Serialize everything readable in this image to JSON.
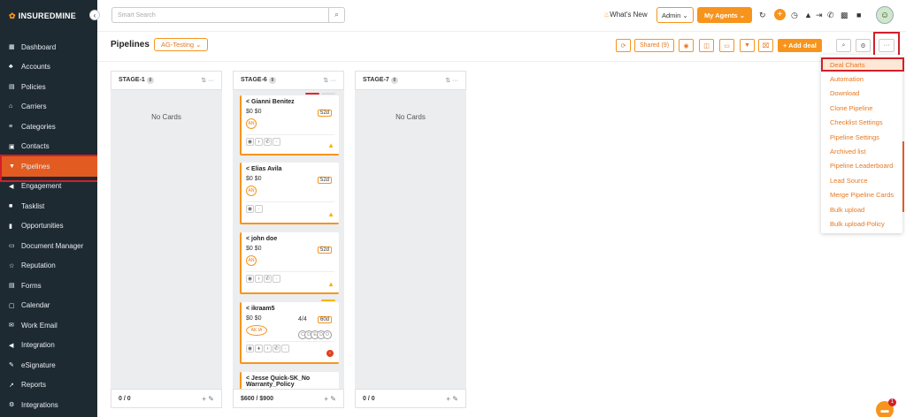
{
  "brand": {
    "name_bold": "INSURED",
    "name_rest": "MINE",
    "accent": "#f7941d"
  },
  "sidebar": {
    "items": [
      {
        "label": "Dashboard",
        "icon": "dashboard-icon"
      },
      {
        "label": "Accounts",
        "icon": "accounts-icon"
      },
      {
        "label": "Policies",
        "icon": "policies-icon"
      },
      {
        "label": "Carriers",
        "icon": "carriers-icon"
      },
      {
        "label": "Categories",
        "icon": "categories-icon"
      },
      {
        "label": "Contacts",
        "icon": "contacts-icon"
      },
      {
        "label": "Pipelines",
        "icon": "pipelines-icon",
        "active": true
      },
      {
        "label": "Engagement",
        "icon": "engagement-icon"
      },
      {
        "label": "Tasklist",
        "icon": "tasklist-icon"
      },
      {
        "label": "Opportunities",
        "icon": "opportunities-icon"
      },
      {
        "label": "Document Manager",
        "icon": "document-manager-icon"
      },
      {
        "label": "Reputation",
        "icon": "reputation-icon"
      },
      {
        "label": "Forms",
        "icon": "forms-icon"
      },
      {
        "label": "Calendar",
        "icon": "calendar-icon"
      },
      {
        "label": "Work Email",
        "icon": "work-email-icon"
      },
      {
        "label": "Integration",
        "icon": "integration-icon"
      },
      {
        "label": "eSignature",
        "icon": "esignature-icon"
      },
      {
        "label": "Reports",
        "icon": "reports-icon"
      },
      {
        "label": "Integrations",
        "icon": "integrations-icon"
      }
    ]
  },
  "topbar": {
    "search_placeholder": "Smart Search",
    "whats_new": "What's New",
    "admin": "Admin ⌄",
    "my_agents": "My Agents ⌄"
  },
  "page": {
    "title": "Pipelines",
    "pipeline_select": "AG-Testing ⌄",
    "shared": "Shared (9)",
    "add_deal": "+ Add deal",
    "more": "···"
  },
  "stages": [
    {
      "name": "STAGE-1",
      "count": "0",
      "empty_text": "No Cards",
      "footer_value": "0 / 0"
    },
    {
      "name": "STAGE-6",
      "count": "9",
      "empty_text": "",
      "footer_value": "$600 / $900"
    },
    {
      "name": "STAGE-7",
      "count": "0",
      "empty_text": "No Cards",
      "footer_value": "0 / 0"
    }
  ],
  "cards": [
    {
      "name": "Gianni Benitez",
      "money": "$0 $0",
      "days": "52d",
      "initials": "AN"
    },
    {
      "name": "Elias Avila",
      "money": "$0 $0",
      "days": "52d",
      "initials": "AN"
    },
    {
      "name": "john doe",
      "money": "$0 $0",
      "days": "52d",
      "initials": "AN"
    },
    {
      "name": "ikraam5",
      "money": "$0 $0",
      "days": "60d",
      "initials": "AK IA",
      "fraction": "4/4"
    },
    {
      "name": "Jesse Quick-SK_No Warranty_Policy",
      "money": "",
      "days": "",
      "initials": ""
    }
  ],
  "menu": {
    "items": [
      "Deal Charts",
      "Automation",
      "Download",
      "Clone Pipeline",
      "Checklist Settings",
      "Pipeline Settings",
      "Archived list",
      "Pipeline Leaderboard",
      "Lead Source",
      "Merge Pipeline Cards",
      "Bulk upload",
      "Bulk upload-Policy"
    ]
  },
  "chat": {
    "badge": "1"
  }
}
